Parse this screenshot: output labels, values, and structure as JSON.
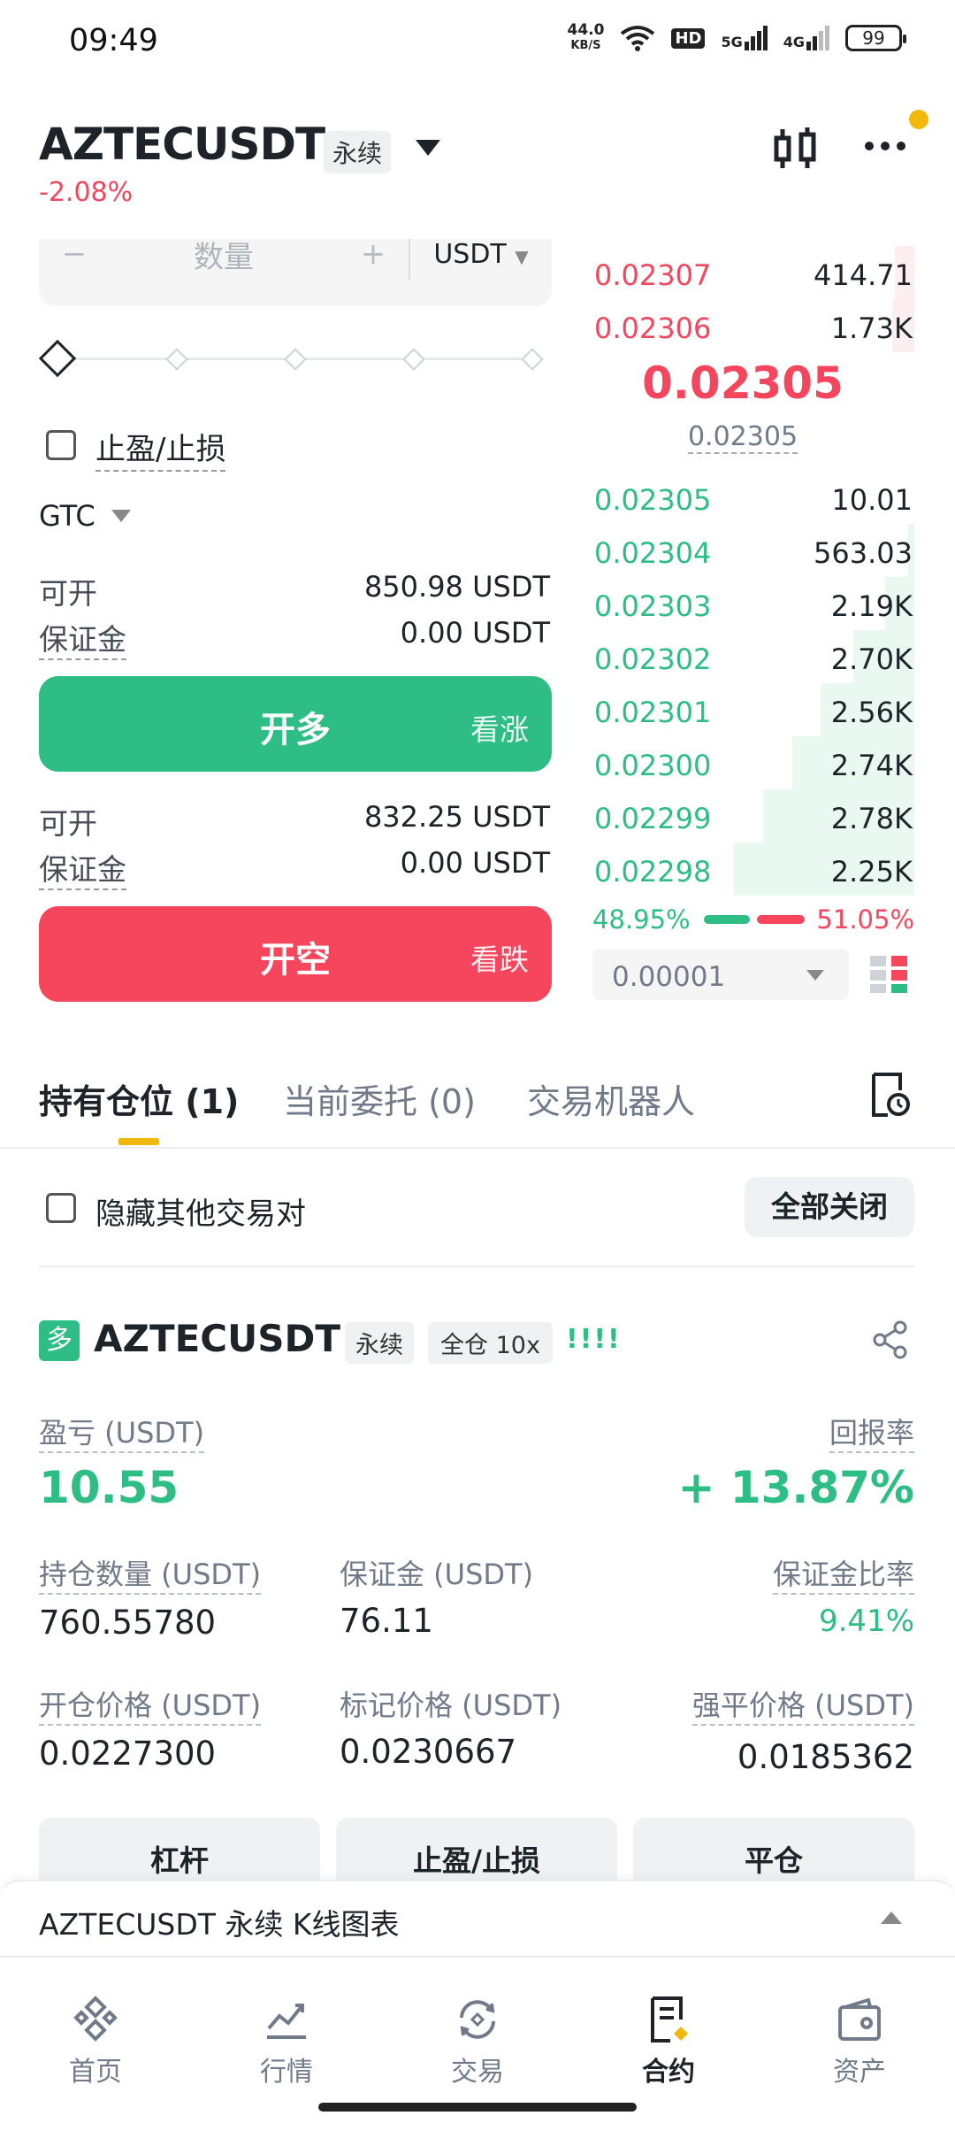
{
  "status_bar": {
    "time": "09:49",
    "net_speed": "44.0",
    "net_unit": "KB/S",
    "hd": "HD",
    "sig1": "5G",
    "sig2": "4G",
    "battery": "99"
  },
  "header": {
    "symbol": "AZTECUSDT",
    "contract_tag": "永续",
    "change": "-2.08%"
  },
  "order_form": {
    "qty_minus": "−",
    "qty_label": "数量",
    "qty_plus": "+",
    "qty_unit": "USDT",
    "tp_sl_label": "止盈/止损",
    "tif": "GTC",
    "long": {
      "avail_label": "可开",
      "avail_value": "850.98 USDT",
      "margin_label": "保证金",
      "margin_value": "0.00 USDT",
      "button": "开多",
      "button_sub": "看涨"
    },
    "short": {
      "avail_label": "可开",
      "avail_value": "832.25 USDT",
      "margin_label": "保证金",
      "margin_value": "0.00 USDT",
      "button": "开空",
      "button_sub": "看跌"
    }
  },
  "order_book": {
    "asks": [
      {
        "price": "0.02307",
        "qty": "414.71",
        "depth": 0.06
      },
      {
        "price": "0.02306",
        "qty": "1.73K",
        "depth": 0.07
      }
    ],
    "last_price": "0.02305",
    "mark_price": "0.02305",
    "bids": [
      {
        "price": "0.02305",
        "qty": "10.01",
        "depth": 0.0
      },
      {
        "price": "0.02304",
        "qty": "563.03",
        "depth": 0.02
      },
      {
        "price": "0.02303",
        "qty": "2.19K",
        "depth": 0.09
      },
      {
        "price": "0.02302",
        "qty": "2.70K",
        "depth": 0.19
      },
      {
        "price": "0.02301",
        "qty": "2.56K",
        "depth": 0.29
      },
      {
        "price": "0.02300",
        "qty": "2.74K",
        "depth": 0.38
      },
      {
        "price": "0.02299",
        "qty": "2.78K",
        "depth": 0.47
      },
      {
        "price": "0.02298",
        "qty": "2.25K",
        "depth": 0.56
      }
    ],
    "buy_ratio": "48.95%",
    "sell_ratio": "51.05%",
    "precision": "0.00001"
  },
  "tabs": {
    "positions": "持有仓位 (1)",
    "open_orders": "当前委托 (0)",
    "bots": "交易机器人"
  },
  "positions_panel": {
    "hide_others_label": "隐藏其他交易对",
    "close_all": "全部关闭",
    "position": {
      "side_badge": "多",
      "symbol": "AZTECUSDT",
      "tag_contract": "永续",
      "tag_margin": "全仓 10x",
      "signal": "!!!!",
      "pnl_label": "盈亏 (USDT)",
      "pnl_value": "10.55",
      "roe_label": "回报率",
      "roe_value": "+ 13.87%",
      "size_label": "持仓数量 (USDT)",
      "size_value": "760.55780",
      "margin_label": "保证金 (USDT)",
      "margin_value": "76.11",
      "margin_ratio_label": "保证金比率",
      "margin_ratio_value": "9.41%",
      "entry_label": "开仓价格 (USDT)",
      "entry_value": "0.0227300",
      "mark_label": "标记价格 (USDT)",
      "mark_value": "0.0230667",
      "liq_label": "强平价格 (USDT)",
      "liq_value": "0.0185362",
      "btn_leverage": "杠杆",
      "btn_tpsl": "止盈/止损",
      "btn_close": "平仓"
    }
  },
  "chart_strip": {
    "label": "AZTECUSDT 永续 K线图表"
  },
  "bottom_nav": {
    "home": "首页",
    "markets": "行情",
    "trade": "交易",
    "futures": "合约",
    "assets": "资产"
  },
  "colors": {
    "green": "#2ebd85",
    "red": "#f6465d",
    "yellow": "#f0b90b"
  }
}
